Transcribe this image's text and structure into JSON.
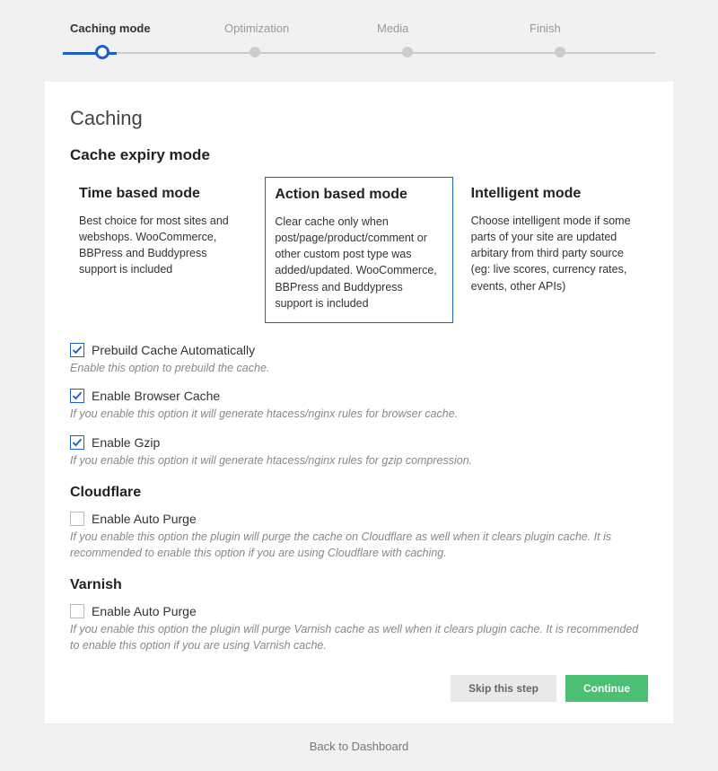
{
  "stepper": {
    "steps": [
      {
        "label": "Caching mode",
        "active": true
      },
      {
        "label": "Optimization",
        "active": false
      },
      {
        "label": "Media",
        "active": false
      },
      {
        "label": "Finish",
        "active": false
      }
    ]
  },
  "page": {
    "title": "Caching"
  },
  "expiry": {
    "heading": "Cache expiry mode",
    "modes": [
      {
        "title": "Time based mode",
        "desc": "Best choice for most sites and webshops. WooCommerce, BBPress and Buddypress support is included",
        "selected": false
      },
      {
        "title": "Action based mode",
        "desc": "Clear cache only when post/page/product/comment or other custom post type was added/updated. WooCommerce, BBPress and Buddypress support is included",
        "selected": true
      },
      {
        "title": "Intelligent mode",
        "desc": "Choose intelligent mode if some parts of your site are updated arbitary from third party source (eg: live scores, currency rates, events, other APIs)",
        "selected": false
      }
    ]
  },
  "options": [
    {
      "label": "Prebuild Cache Automatically",
      "help": "Enable this option to prebuild the cache.",
      "checked": true
    },
    {
      "label": "Enable Browser Cache",
      "help": "If you enable this option it will generate htacess/nginx rules for browser cache.",
      "checked": true
    },
    {
      "label": "Enable Gzip",
      "help": "If you enable this option it will generate htacess/nginx rules for gzip compression.",
      "checked": true
    }
  ],
  "cloudflare": {
    "heading": "Cloudflare",
    "option": {
      "label": "Enable Auto Purge",
      "help": "If you enable this option the plugin will purge the cache on Cloudflare as well when it clears plugin cache. It is recommended to enable this option if you are using Cloudflare with caching.",
      "checked": false
    }
  },
  "varnish": {
    "heading": "Varnish",
    "option": {
      "label": "Enable Auto Purge",
      "help": "If you enable this option the plugin will purge Varnish cache as well when it clears plugin cache. It is recommended to enable this option if you are using Varnish cache.",
      "checked": false
    }
  },
  "actions": {
    "skip": "Skip this step",
    "continue": "Continue"
  },
  "back": "Back to Dashboard"
}
